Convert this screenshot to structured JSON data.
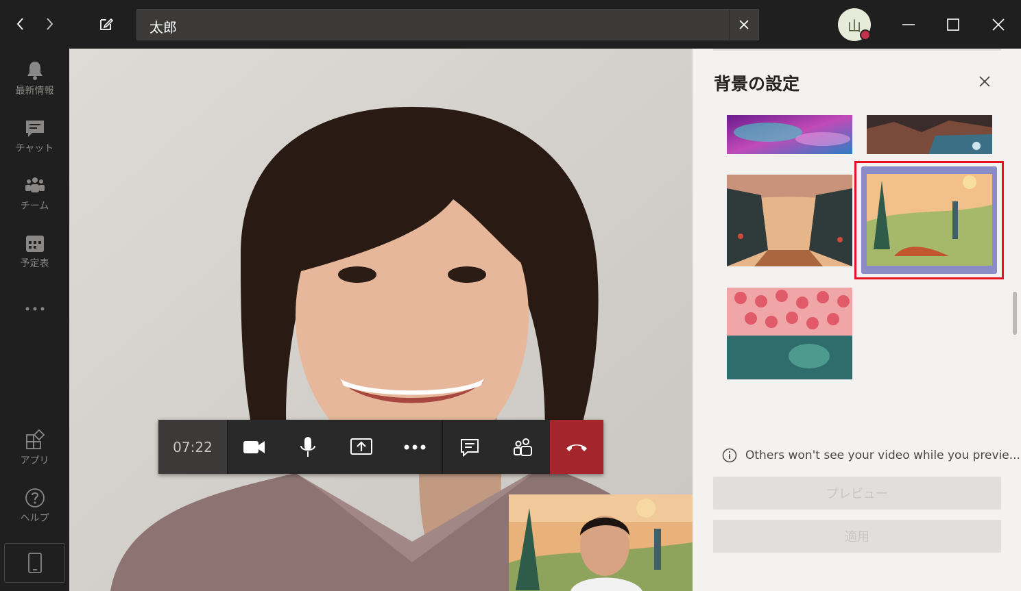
{
  "titlebar": {
    "back_icon": "chevron-left-icon",
    "forward_icon": "chevron-right-icon",
    "compose_icon": "compose-icon",
    "search_value": "太郎",
    "clear_icon": "close-icon",
    "avatar_initial": "山",
    "status_color": "#c4314b"
  },
  "rail": {
    "items": [
      {
        "label": "最新情報",
        "icon": "bell-icon"
      },
      {
        "label": "チャット",
        "icon": "chat-icon"
      },
      {
        "label": "チーム",
        "icon": "teams-icon"
      },
      {
        "label": "予定表",
        "icon": "calendar-icon"
      },
      {
        "label": "",
        "icon": "more-icon"
      },
      {
        "label": "アプリ",
        "icon": "apps-icon"
      },
      {
        "label": "ヘルプ",
        "icon": "help-icon"
      }
    ]
  },
  "call": {
    "timer": "07:22",
    "hangup_color": "#a4262c"
  },
  "panel": {
    "title": "背景の設定",
    "info_text": "Others won't see your video while you previe...",
    "preview_label": "プレビュー",
    "apply_label": "適用",
    "selected_highlight": "#e81123",
    "selected_border": "#8b8cc7"
  }
}
